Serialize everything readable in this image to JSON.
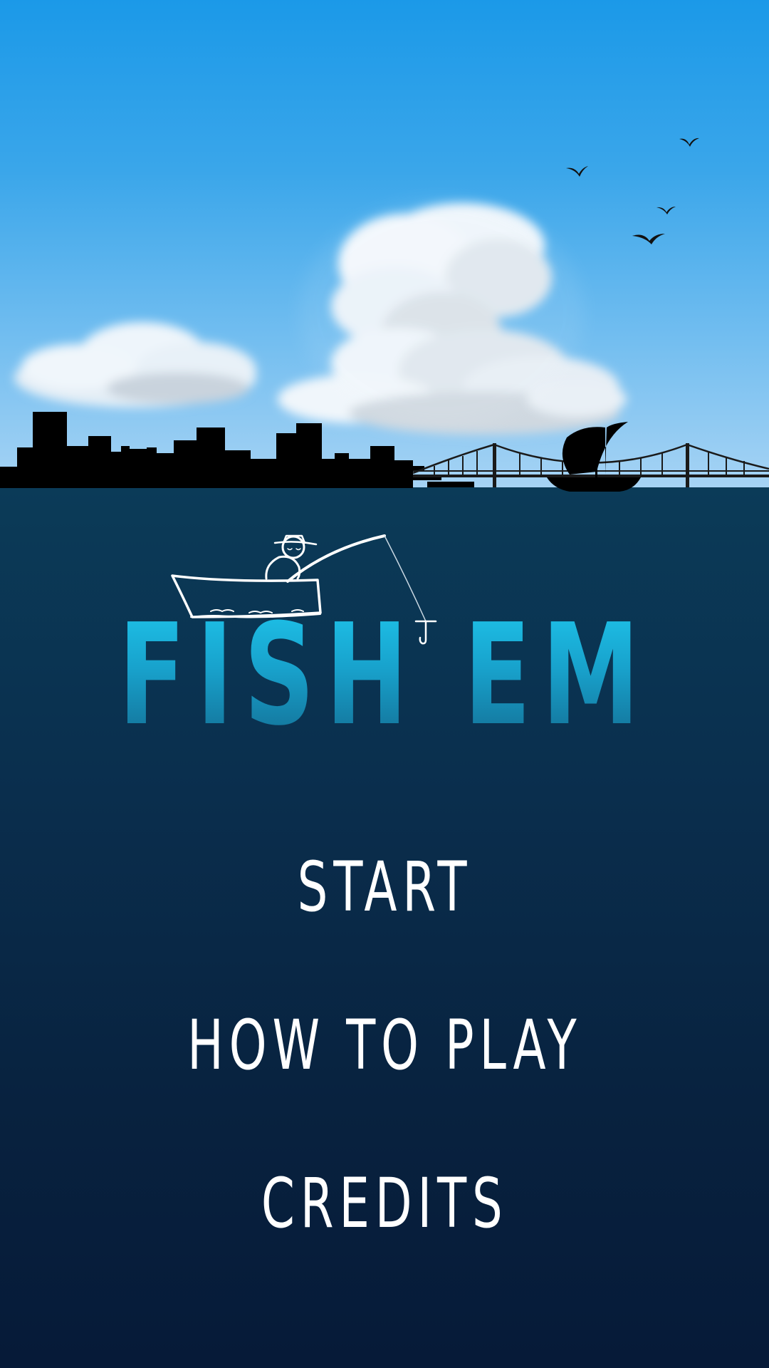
{
  "game": {
    "title": "FISH EM"
  },
  "menu": {
    "start_label": "START",
    "how_to_play_label": "HOW TO PLAY",
    "credits_label": "CREDITS"
  },
  "colors": {
    "sky_top": "#1b99e8",
    "sky_bottom": "#a6d3f4",
    "water_top": "#0b3b58",
    "water_bottom": "#061a38",
    "title_top": "#1ec3ea",
    "title_bottom": "#136d93",
    "menu_text": "#ffffff",
    "silhouette": "#000000"
  },
  "scene": {
    "elements": [
      "birds",
      "clouds",
      "city-skyline",
      "suspension-bridge",
      "sailboat",
      "fisherman-in-boat",
      "fishing-hook"
    ]
  }
}
